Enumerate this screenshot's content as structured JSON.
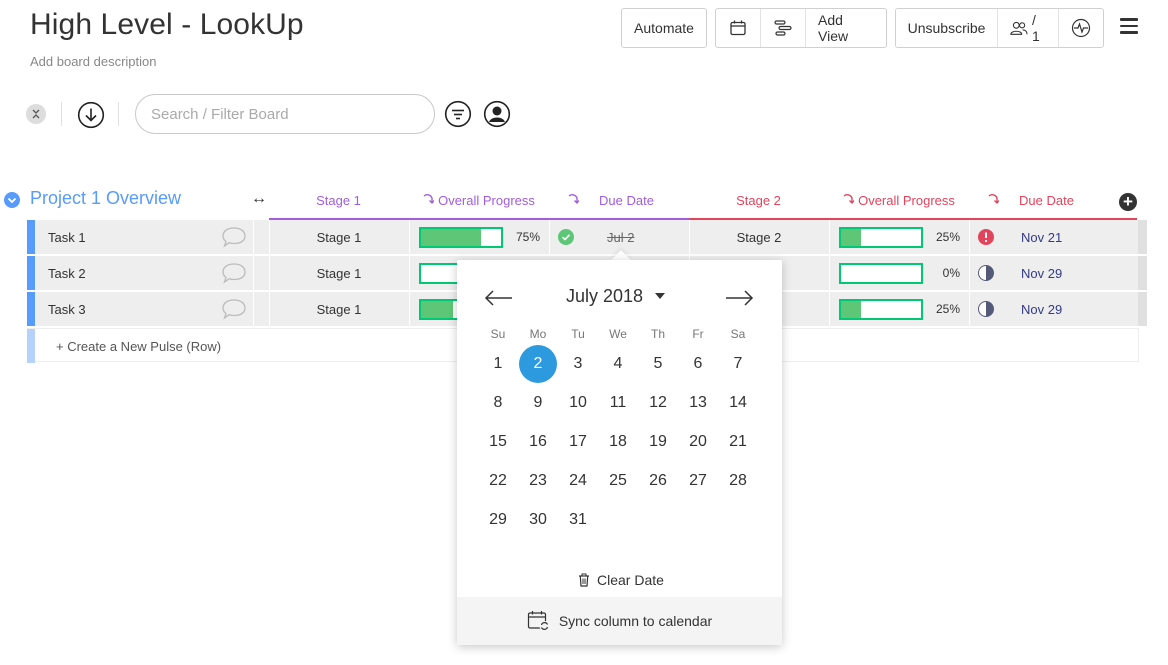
{
  "board": {
    "title": "High Level - LookUp",
    "description": "Add board description"
  },
  "toolbar": {
    "automate": "Automate",
    "add_view": "Add View",
    "unsubscribe": "Unsubscribe",
    "members": "/ 1"
  },
  "filter": {
    "search_placeholder": "Search / Filter Board"
  },
  "group": {
    "title": "Project 1 Overview",
    "color": "#579bfc"
  },
  "columns": {
    "stage1": "Stage 1",
    "progress1": "Overall Progress",
    "due1": "Due Date",
    "stage2": "Stage 2",
    "progress2": "Overall Progress",
    "due2": "Due Date"
  },
  "rows": [
    {
      "name": "Task 1",
      "stage1": "Stage 1",
      "progress1": 75,
      "progress1_label": "75%",
      "due1": "Jul 2",
      "stage2": "Stage 2",
      "progress2": 25,
      "progress2_label": "25%",
      "due2": "Nov 21",
      "status2": "overdue"
    },
    {
      "name": "Task 2",
      "stage1": "Stage 1",
      "progress1": 0,
      "progress1_label": "",
      "due1": "",
      "stage2": "",
      "progress2": 0,
      "progress2_label": "0%",
      "due2": "Nov 29",
      "status2": "half"
    },
    {
      "name": "Task 3",
      "stage1": "Stage 1",
      "progress1": 40,
      "progress1_label": "",
      "due1": "",
      "stage2": "",
      "progress2": 25,
      "progress2_label": "25%",
      "due2": "Nov 29",
      "status2": "half"
    }
  ],
  "new_row_label": "+ Create a New Pulse (Row)",
  "datepicker": {
    "month_label": "July 2018",
    "weekdays": [
      "Su",
      "Mo",
      "Tu",
      "We",
      "Th",
      "Fr",
      "Sa"
    ],
    "days": [
      1,
      2,
      3,
      4,
      5,
      6,
      7,
      8,
      9,
      10,
      11,
      12,
      13,
      14,
      15,
      16,
      17,
      18,
      19,
      20,
      21,
      22,
      23,
      24,
      25,
      26,
      27,
      28,
      29,
      30,
      31
    ],
    "selected_day": 2,
    "first_weekday_index": 0,
    "clear_label": "Clear Date",
    "sync_label": "Sync column to calendar",
    "selected_color": "#2d9ae0"
  },
  "colors": {
    "stage1_accent": "#a25ddc",
    "stage2_accent": "#e2445c",
    "progress_fill": "#5dc777",
    "progress_border": "#00c875",
    "done_green": "#5dc777",
    "stuck_red": "#e2445c"
  }
}
